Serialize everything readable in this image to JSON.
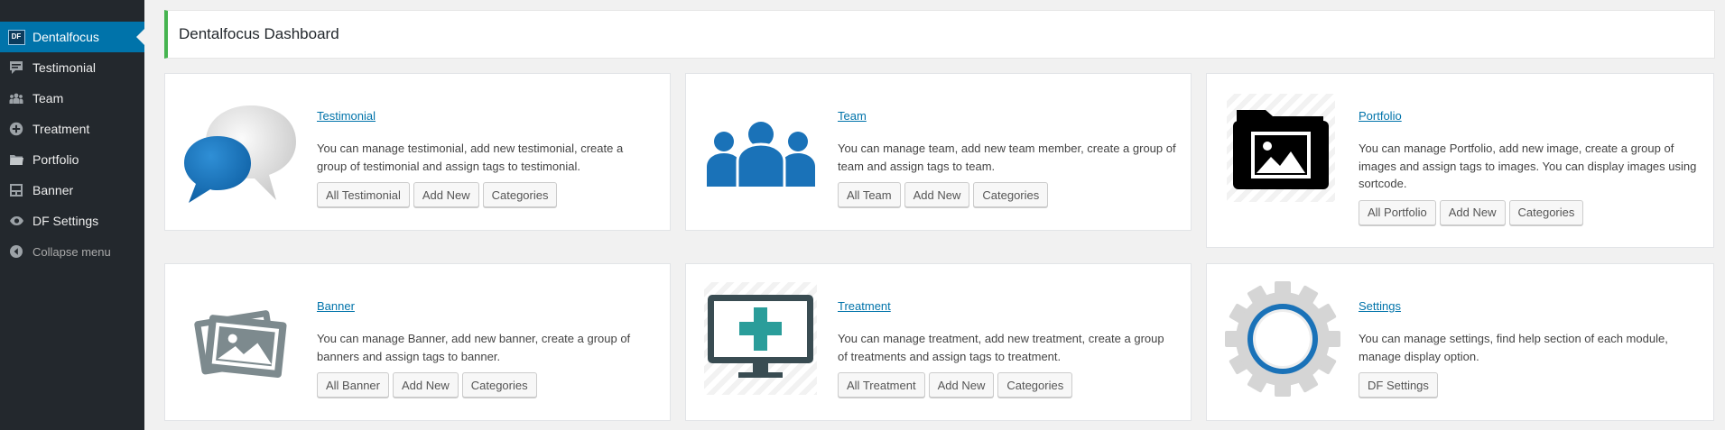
{
  "sidebar": {
    "items": [
      {
        "label": "Dentalfocus",
        "icon": "df-logo-icon"
      },
      {
        "label": "Testimonial",
        "icon": "comment-icon"
      },
      {
        "label": "Team",
        "icon": "groups-icon"
      },
      {
        "label": "Treatment",
        "icon": "plus-circle-icon"
      },
      {
        "label": "Portfolio",
        "icon": "portfolio-icon"
      },
      {
        "label": "Banner",
        "icon": "slides-icon"
      },
      {
        "label": "DF Settings",
        "icon": "settings-icon"
      }
    ],
    "df_badge": "DF",
    "collapse_label": "Collapse menu"
  },
  "header": {
    "title": "Dentalfocus Dashboard"
  },
  "cards": {
    "testimonial": {
      "title": "Testimonial",
      "description": "You can manage testimonial, add new testimonial, create a group of testimonial and assign tags to testimonial.",
      "buttons": [
        "All Testimonial",
        "Add New",
        "Categories"
      ],
      "icon": "speech-bubbles-icon"
    },
    "team": {
      "title": "Team",
      "description": "You can manage team, add new team member, create a group of team and assign tags to team.",
      "buttons": [
        "All Team",
        "Add New",
        "Categories"
      ],
      "icon": "team-people-icon"
    },
    "portfolio": {
      "title": "Portfolio",
      "description": "You can manage Portfolio, add new image, create a group of images and assign tags to images. You can display images using sortcode.",
      "buttons": [
        "All Portfolio",
        "Add New",
        "Categories"
      ],
      "icon": "folder-image-icon"
    },
    "banner": {
      "title": "Banner",
      "description": "You can manage Banner, add new banner, create a group of banners and assign tags to banner.",
      "buttons": [
        "All Banner",
        "Add New",
        "Categories"
      ],
      "icon": "photos-icon"
    },
    "treatment": {
      "title": "Treatment",
      "description": "You can manage treatment, add new treatment, create a group of treatments and assign tags to treatment.",
      "buttons": [
        "All Treatment",
        "Add New",
        "Categories"
      ],
      "icon": "monitor-plus-icon"
    },
    "settings": {
      "title": "Settings",
      "description": "You can manage settings, find help section of each module, manage display option.",
      "buttons": [
        "DF Settings"
      ],
      "icon": "gear-icon"
    }
  },
  "colors": {
    "sidebar_bg": "#23282d",
    "active_bg": "#0073aa",
    "link": "#0073aa",
    "header_accent": "#46b450",
    "icon_blue": "#1a72b8",
    "icon_teal": "#2a9d9a",
    "icon_dark": "#394c52"
  }
}
